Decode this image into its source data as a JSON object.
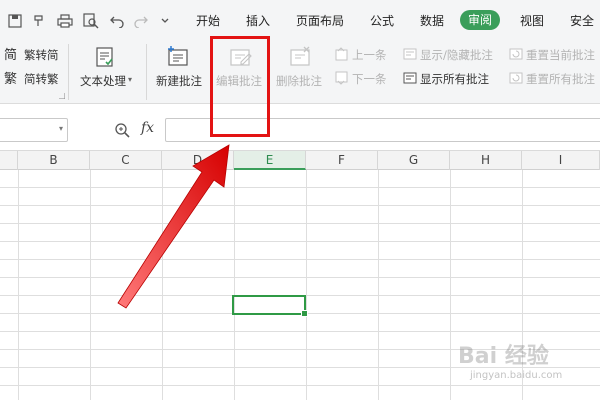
{
  "menubar": {
    "tabs": [
      "开始",
      "插入",
      "页面布局",
      "公式",
      "数据",
      "审阅",
      "视图",
      "安全"
    ],
    "active_tab": "审阅"
  },
  "ribbon": {
    "convert_trad": "繁转简",
    "convert_simp": "简转繁",
    "text_processing": "文本处理",
    "new_comment": "新建批注",
    "edit_comment": "编辑批注",
    "delete_comment": "删除批注",
    "previous": "上一条",
    "next": "下一条",
    "show_hide_comment": "显示/隐藏批注",
    "show_all_comments": "显示所有批注",
    "reset_current_comment": "重置当前批注",
    "reset_all_comments": "重置所有批注"
  },
  "formula_bar": {
    "fx_label": "fx",
    "cell_value": ""
  },
  "columns": [
    "B",
    "C",
    "D",
    "E",
    "F",
    "G",
    "H",
    "I"
  ],
  "selected_column": "E",
  "watermark": {
    "main": "Bai 经验",
    "sub": "jingyan.baidu.com"
  },
  "colors": {
    "accent": "#3a9e5a",
    "highlight": "#e31313"
  }
}
